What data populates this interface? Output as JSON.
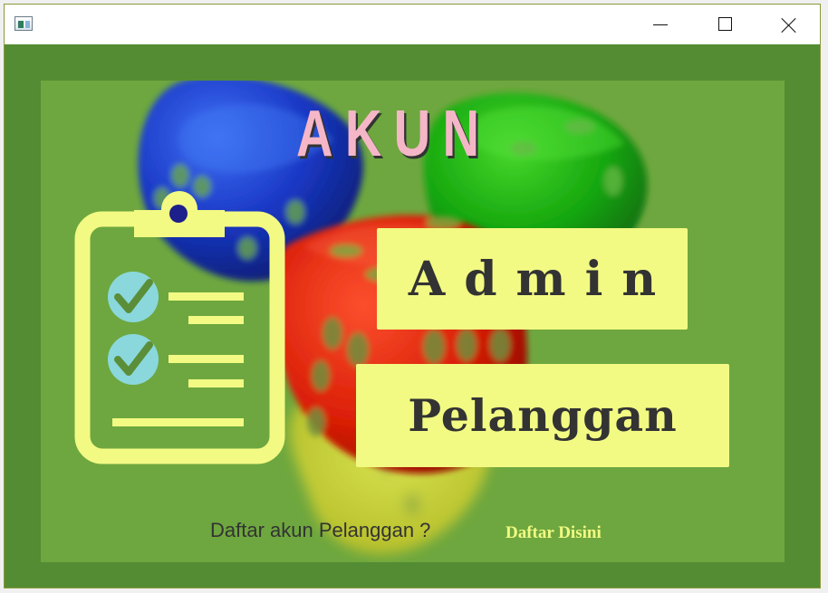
{
  "window": {
    "title": "",
    "controls": {
      "minimize_icon": "minimize-icon",
      "maximize_icon": "maximize-icon",
      "close_icon": "close-icon"
    }
  },
  "page": {
    "title": "AKUN",
    "buttons": {
      "admin": "Admin",
      "customer": "Pelanggan"
    },
    "footer": {
      "prompt": "Daftar akun Pelanggan ?",
      "link": "Daftar Disini"
    }
  },
  "illustrations": {
    "background": "four translucent dice: blue, green, red, yellow",
    "clipboard": "clipboard-icon"
  },
  "colors": {
    "outer_background": "#548c33",
    "panel": "#6ea73f",
    "button_fill": "#f2fa83",
    "button_text": "#333333",
    "title_text": "#f5b7c8",
    "check_circle": "#8ad8dc",
    "clipboard": "#f2fa83"
  }
}
